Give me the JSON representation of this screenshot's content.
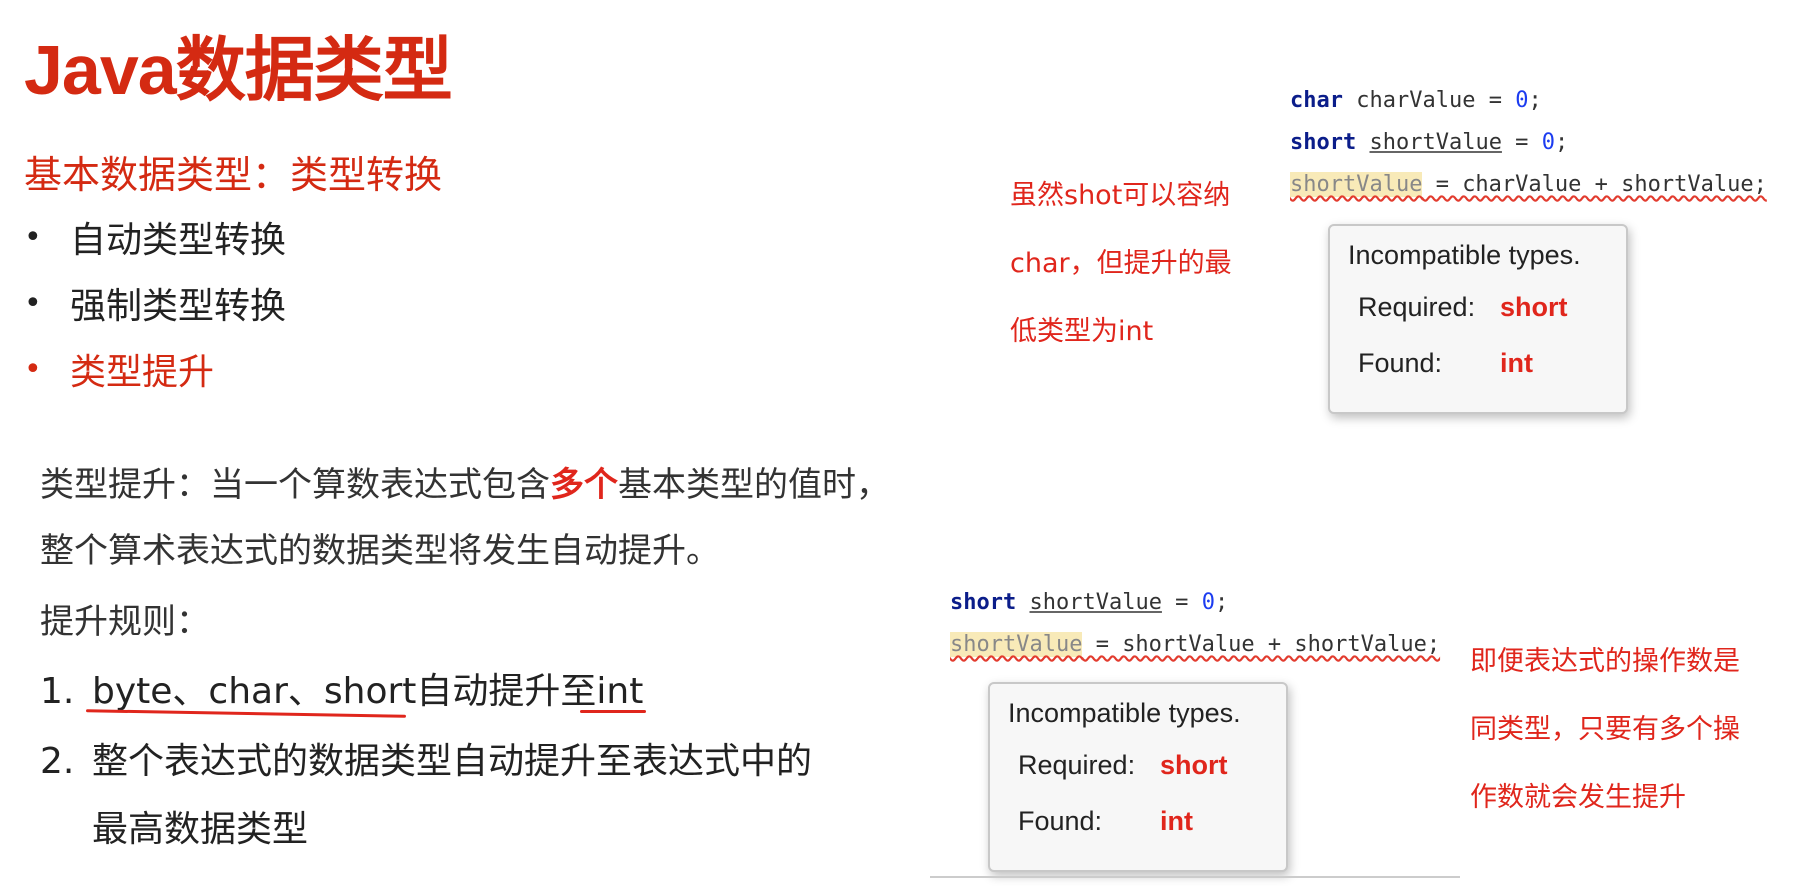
{
  "title": "Java数据类型",
  "subtitle": "基本数据类型：类型转换",
  "bullets": [
    {
      "text": "自动类型转换"
    },
    {
      "text": "强制类型转换"
    },
    {
      "text": "类型提升"
    }
  ],
  "bullet_symbol": "•",
  "paragraph": {
    "part1": "类型提升：当一个算数表达式包含",
    "emphasis": "多个",
    "part2": "基本类型的值时，整个算术表达式的数据类型将发生自动提升。"
  },
  "rules_title": "提升规则：",
  "rules": [
    {
      "num": "1.",
      "text": "byte、char、short自动提升至int"
    },
    {
      "num": "2.",
      "text": "整个表达式的数据类型自动提升至表达式中的"
    }
  ],
  "rule2_cont": "最高数据类型",
  "code1": {
    "line1_kw": "char",
    "line1_var": "charValue",
    "line1_rest": " = ",
    "line1_num": "0",
    "line1_end": ";",
    "line2_kw": "short",
    "line2_var": "shortValue",
    "line2_rest": " = ",
    "line2_num": "0",
    "line2_end": ";",
    "line3_hl": "shortValue",
    "line3_rest": " = charValue + shortValue;"
  },
  "tooltip1": {
    "head": "Incompatible types.",
    "required_label": "Required:",
    "required_val": "short",
    "found_label": "Found:",
    "found_val": "int"
  },
  "note1": {
    "line1": "虽然shot可以容纳",
    "line2": "char，但提升的最",
    "line3": "低类型为int"
  },
  "code2": {
    "line1_kw": "short",
    "line1_var": "shortValue",
    "line1_rest": " = ",
    "line1_num": "0",
    "line1_end": ";",
    "line2_hl": "shortValue",
    "line2_rest": " = shortValue + shortValue;"
  },
  "tooltip2": {
    "head": "Incompatible types.",
    "required_label": "Required:",
    "required_val": "short",
    "found_label": "Found:",
    "found_val": "int"
  },
  "note2": {
    "line1": "即便表达式的操作数是",
    "line2": "同类型，只要有多个操",
    "line3": "作数就会发生提升"
  },
  "colors": {
    "accent_red": "#d42a12",
    "keyword": "#0b1d8a",
    "number": "#1c3cf0"
  }
}
